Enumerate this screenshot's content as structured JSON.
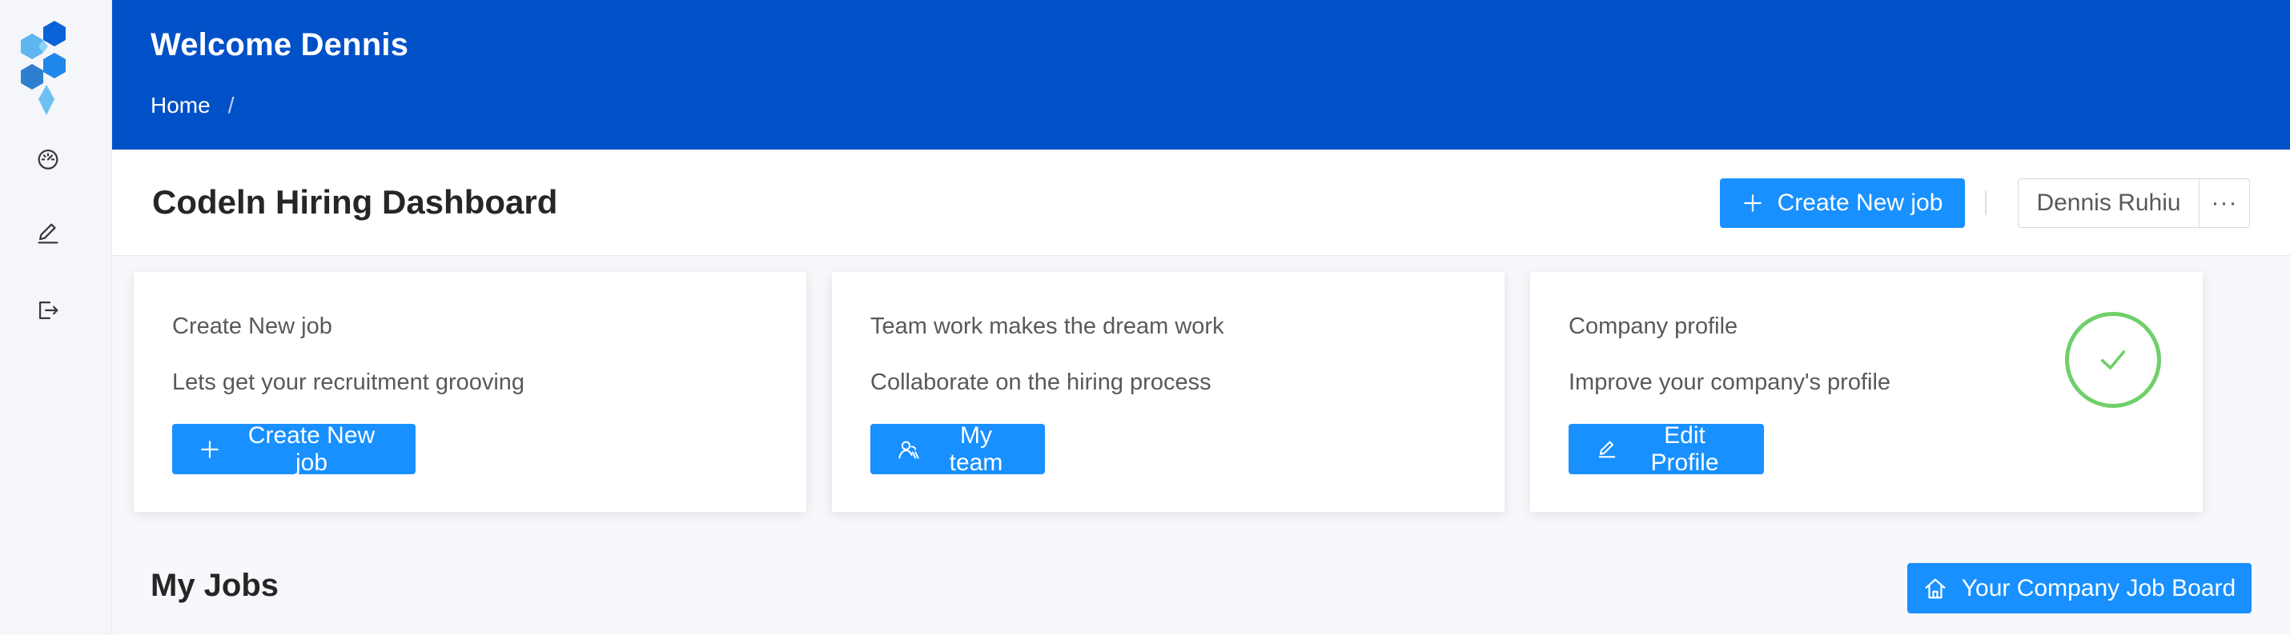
{
  "sidebar": {
    "icons": [
      "dashboard-icon",
      "edit-icon",
      "logout-icon"
    ]
  },
  "header": {
    "welcome": "Welcome Dennis",
    "breadcrumb": {
      "home": "Home",
      "separator": "/"
    }
  },
  "titlebar": {
    "title": "Codeln Hiring Dashboard",
    "create_label": "Create New job",
    "user_name": "Dennis Ruhiu",
    "more_label": "···"
  },
  "cards": [
    {
      "title": "Create New job",
      "desc": "Lets get your recruitment grooving",
      "button": "Create New job",
      "icon": "plus-icon"
    },
    {
      "title": "Team work makes the dream work",
      "desc": "Collaborate on the hiring process",
      "button": "My team",
      "icon": "team-icon"
    },
    {
      "title": "Company profile",
      "desc": "Improve your company's profile",
      "button": "Edit Profile",
      "icon": "edit-icon",
      "completed": true
    }
  ],
  "jobs": {
    "title": "My Jobs",
    "board_button": "Your Company Job Board"
  },
  "colors": {
    "header_bg": "#0050c8",
    "primary": "#1890ff",
    "success": "#6fcf6a",
    "page_bg": "#f7f8fb"
  }
}
